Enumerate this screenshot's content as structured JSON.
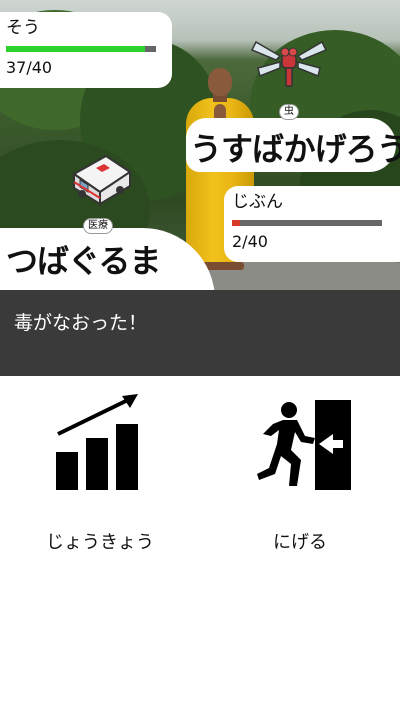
{
  "enemy": {
    "name_small": "そう",
    "hp_text": "37/40",
    "hp_fraction": 0.925,
    "hp_color": "#2ed12e",
    "type_badge": "虫",
    "big_name": "うすばかげろう",
    "sprite": "dragonfly-icon"
  },
  "player": {
    "name_small": "じぶん",
    "hp_text": "2/40",
    "hp_fraction": 0.05,
    "hp_color": "#d83a2a",
    "type_badge": "医療",
    "big_name": "つばぐるま",
    "sprite": "ambulance-icon"
  },
  "message": "毒がなおった！",
  "commands": {
    "status": {
      "label": "じょうきょう",
      "icon": "chart-up-icon"
    },
    "escape": {
      "label": "にげる",
      "icon": "exit-run-icon"
    }
  },
  "colors": {
    "message_bg": "#3a3a3a",
    "page_bg": "#ffffff"
  }
}
